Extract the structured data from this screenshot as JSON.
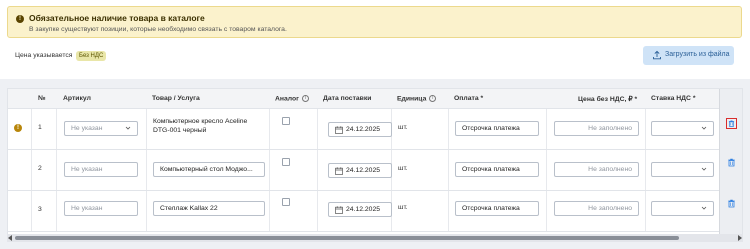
{
  "alert": {
    "title": "Обязательное наличие товара в каталоге",
    "text": "В закупке существуют позиции, которые необходимо связать с товаром каталога."
  },
  "price": {
    "label": "Цена указывается",
    "vat_badge": "Без НДС"
  },
  "upload_button": "Загрузить из файла",
  "table": {
    "headers": {
      "num": "№",
      "article": "Артикул",
      "product": "Товар / Услуга",
      "analog": "Аналог",
      "delivery": "Дата поставки",
      "unit": "Единица",
      "payment": "Оплата *",
      "price": "Цена без НДС, ₽ *",
      "vat_rate": "Ставка НДС *"
    },
    "rows": [
      {
        "num": "1",
        "article": "Не указан",
        "product": "Компьютерное кресло Aceline DTG-001 черный",
        "date": "24.12.2025",
        "unit": "шт.",
        "payment": "Отсрочка платежа",
        "price": "Не заполнено",
        "vat": ""
      },
      {
        "num": "2",
        "article": "Не указан",
        "product": "Компьютерный стол Моджо...",
        "date": "24.12.2025",
        "unit": "шт.",
        "payment": "Отсрочка платежа",
        "price": "Не заполнено",
        "vat": ""
      },
      {
        "num": "3",
        "article": "Не указан",
        "product": "Стеллаж Kallax 22",
        "date": "24.12.2025",
        "unit": "шт.",
        "payment": "Отсрочка платежа",
        "price": "Не заполнено",
        "vat": ""
      }
    ]
  },
  "icons": {
    "alert": "exclamation-icon",
    "upload": "upload-icon",
    "delete": "trash-icon",
    "calendar": "calendar-icon",
    "info": "info-icon"
  },
  "colors": {
    "accent": "#2a7de1",
    "warning_bg": "#fbf2cc",
    "delete_highlight": "#d92c2c"
  }
}
